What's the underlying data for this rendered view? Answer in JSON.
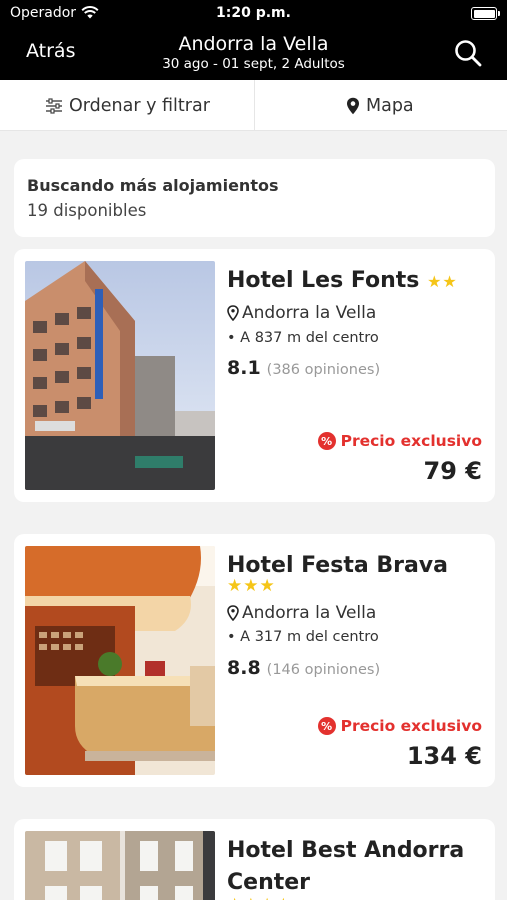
{
  "status_bar": {
    "carrier": "Operador",
    "time": "1:20 p.m."
  },
  "nav": {
    "back_label": "Atrás",
    "title": "Andorra la Vella",
    "subtitle": "30 ago - 01 sept, 2 Adultos",
    "search_icon": "search-icon"
  },
  "filters": {
    "sort_label": "Ordenar y filtrar",
    "map_label": "Mapa"
  },
  "search_status": {
    "title": "Buscando más alojamientos",
    "count": "19 disponibles"
  },
  "hotels": [
    {
      "name": "Hotel Les Fonts",
      "stars": "★★",
      "location": "Andorra la Vella",
      "distance": "• A 837 m del centro",
      "score": "8.1",
      "reviews": "(386 opiniones)",
      "promo": "Precio exclusivo",
      "price": "79 €"
    },
    {
      "name": "Hotel Festa Brava",
      "stars": "★★★",
      "location": "Andorra la Vella",
      "distance": "• A 317 m del centro",
      "score": "8.8",
      "reviews": "(146 opiniones)",
      "promo": "Precio exclusivo",
      "price": "134 €"
    },
    {
      "name": "Hotel Best Andorra Center",
      "stars": "★★★★"
    }
  ],
  "colors": {
    "accent_red": "#e3312e",
    "star_yellow": "#f5c518",
    "header_bg": "#000000"
  }
}
